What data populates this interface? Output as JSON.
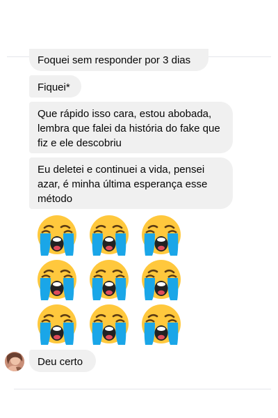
{
  "messages": [
    {
      "text": "Foquei sem responder por 3 dias"
    },
    {
      "text": "Fiquei*"
    },
    {
      "text": "Que rápido isso cara, estou abobada, lembra que falei da história do fake que fiz e ele descobriu"
    },
    {
      "text": "Eu deletei e continuei a vida, pensei azar, é minha última esperança esse método"
    },
    {
      "text": "Deu certo"
    }
  ],
  "emoji_message": {
    "emojis": [
      "loudly-crying-face",
      "loudly-crying-face",
      "loudly-crying-face",
      "loudly-crying-face",
      "loudly-crying-face",
      "loudly-crying-face",
      "loudly-crying-face",
      "loudly-crying-face",
      "loudly-crying-face"
    ]
  },
  "sender": {
    "avatar": "avatar-photo"
  },
  "colors": {
    "bubble_bg": "#f0f0f0",
    "text": "#050505",
    "divider": "#e4e6eb",
    "emoji_face": "#ffc83d",
    "emoji_tears": "#1aa6e8",
    "emoji_mouth": "#222222"
  }
}
